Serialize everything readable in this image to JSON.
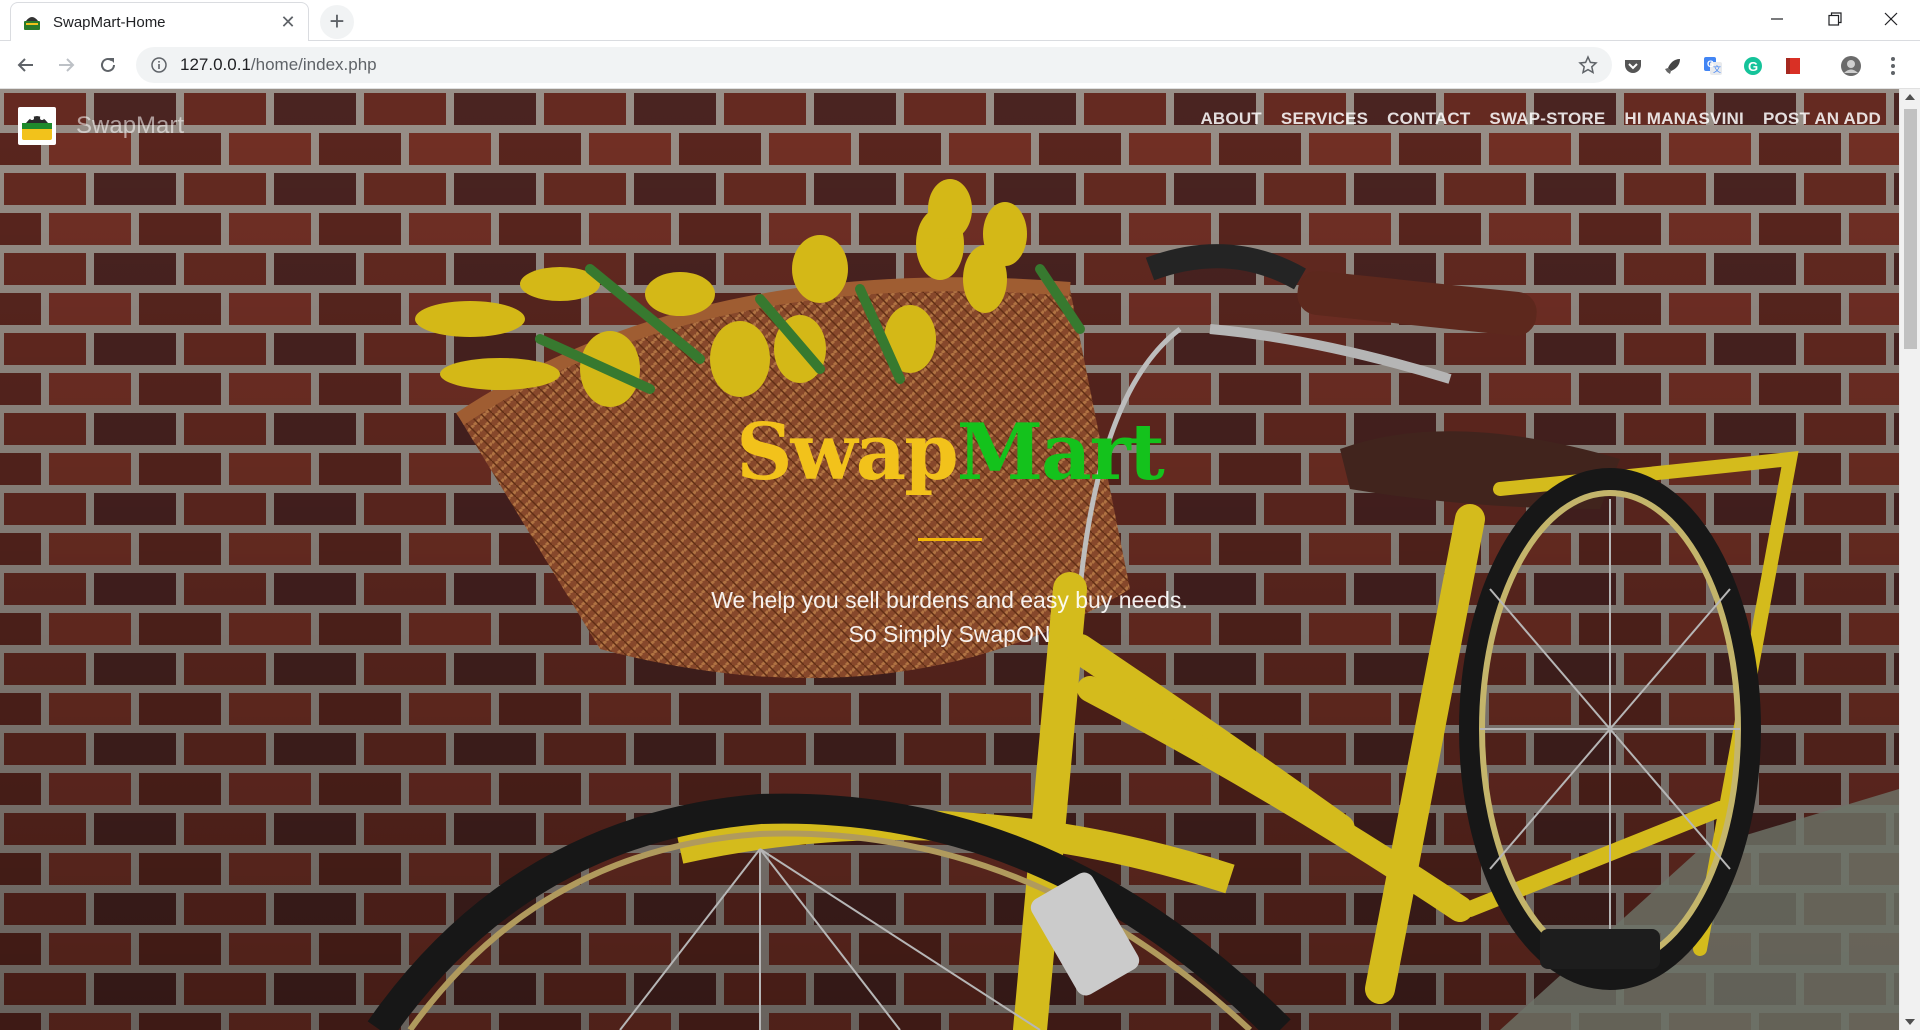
{
  "browser": {
    "tab_title": "SwapMart-Home",
    "url_host": "127.0.0.1",
    "url_path": "/home/index.php"
  },
  "site": {
    "brand": "SwapMart",
    "nav": [
      "ABOUT",
      "SERVICES",
      "CONTACT",
      "SWAP-STORE",
      "HI MANASVINI",
      "POST AN ADD"
    ],
    "hero_title_part1": "Swap",
    "hero_title_part2": "Mart",
    "tagline_line1": "We help you sell burdens and easy buy needs.",
    "tagline_line2": "So Simply SwapON"
  },
  "colors": {
    "title_yellow": "#f2c21b",
    "title_green": "#14c21c",
    "accent_rule": "#f2b705"
  },
  "icons": {
    "tab": "swapmart-favicon",
    "nav": [
      "back-icon",
      "forward-icon",
      "reload-icon"
    ],
    "omnibox": [
      "info-icon",
      "star-icon"
    ],
    "extensions": [
      "pocket-icon",
      "rocket-icon",
      "translate-icon",
      "grammarly-icon",
      "bookmark-red-icon",
      "profile-icon",
      "menu-icon"
    ]
  }
}
